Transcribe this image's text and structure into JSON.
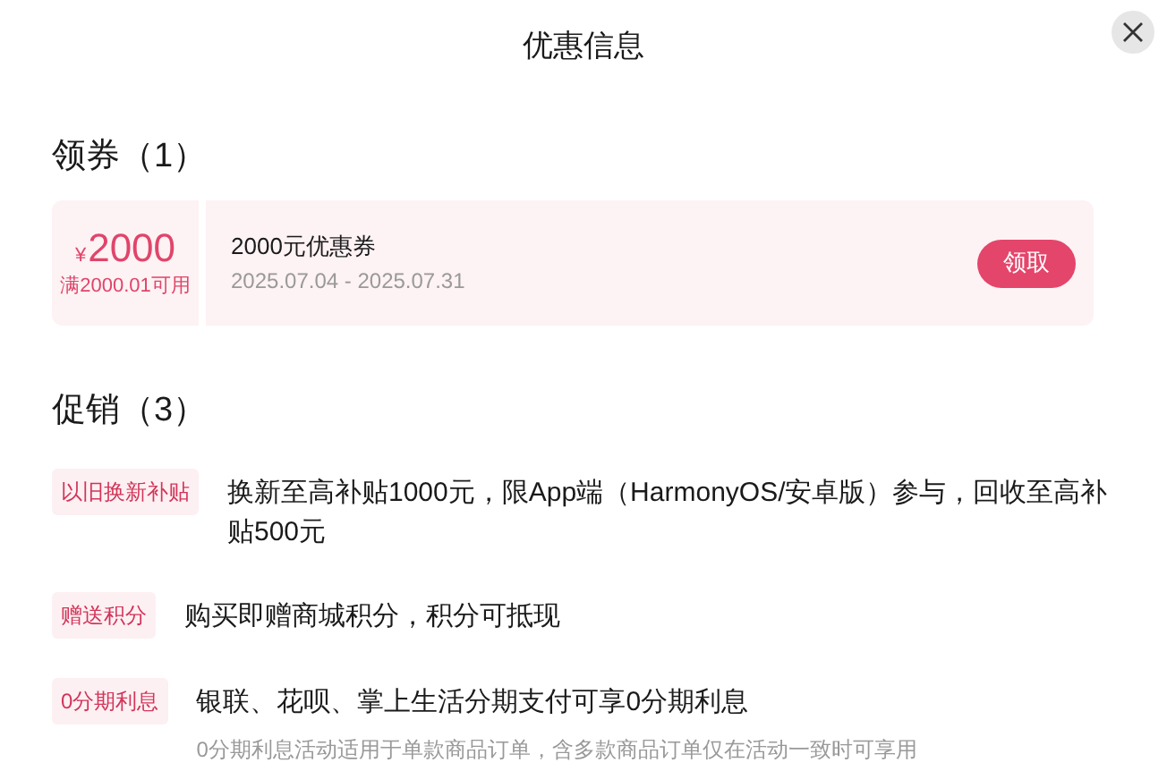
{
  "dialog": {
    "title": "优惠信息"
  },
  "coupons": {
    "heading": "领券（1）",
    "items": [
      {
        "currency": "¥",
        "amount": "2000",
        "condition": "满2000.01可用",
        "name": "2000元优惠券",
        "validity": "2025.07.04 - 2025.07.31",
        "button": "领取"
      }
    ]
  },
  "promotions": {
    "heading": "促销（3）",
    "items": [
      {
        "tag": "以旧换新补贴",
        "text": "换新至高补贴1000元，限App端（HarmonyOS/安卓版）参与，回收至高补贴500元"
      },
      {
        "tag": "赠送积分",
        "text": "购买即赠商城积分，积分可抵现"
      },
      {
        "tag": "0分期利息",
        "text": "银联、花呗、掌上生活分期支付可享0分期利息",
        "note": "0分期利息活动适用于单款商品订单，含多款商品订单仅在活动一致时可享用"
      }
    ]
  }
}
